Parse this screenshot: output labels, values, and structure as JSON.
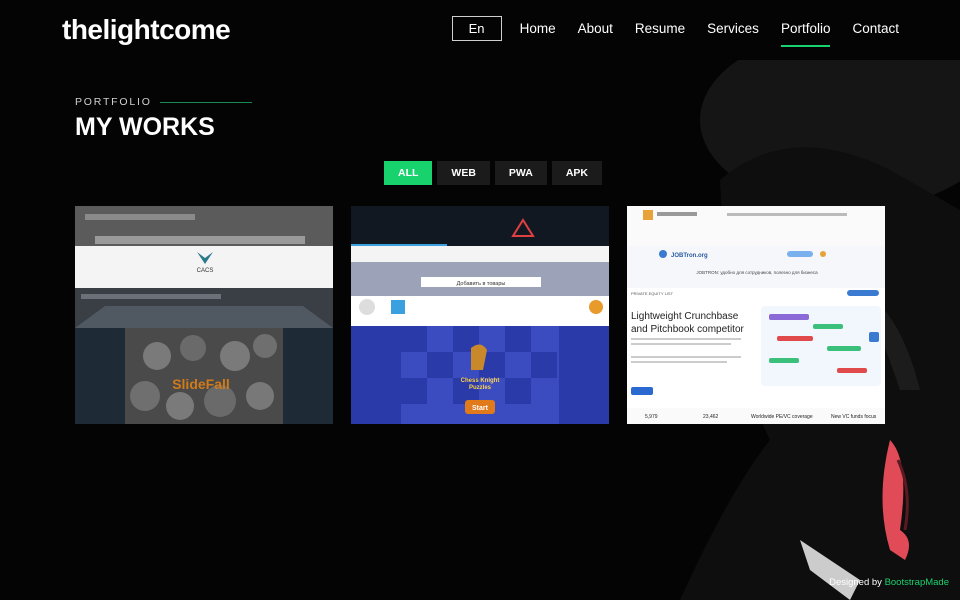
{
  "brand": {
    "logo": "thelightcome"
  },
  "nav": {
    "lang": "En",
    "items": [
      "Home",
      "About",
      "Resume",
      "Services",
      "Portfolio",
      "Contact"
    ],
    "active": "Portfolio"
  },
  "section": {
    "subtitle": "PORTFOLIO",
    "title": "MY WORKS"
  },
  "filters": [
    {
      "label": "ALL",
      "active": true
    },
    {
      "label": "WEB",
      "active": false
    },
    {
      "label": "PWA",
      "active": false
    },
    {
      "label": "APK",
      "active": false
    }
  ],
  "portfolio": {
    "card1": {
      "caas_label": "CACS",
      "game_label": "SlideFall"
    },
    "card2": {
      "game_label_1": "Chess Knight",
      "game_label_2": "Puzzles",
      "game_start": "Start",
      "search_button": "Добавить в товары"
    },
    "card3": {
      "brand": "JOBTron.org",
      "tagline": "JOBTRON: удобно для сотрудников, полезно для бизнеса",
      "headline_1": "Lightweight Crunchbase",
      "headline_2": "and Pitchbook competitor",
      "site_name": "PRIVATE EQUITY LIST",
      "stats": [
        "5,979",
        "23,462",
        "Worldwide PE/VC coverage",
        "New VC funds focus"
      ]
    }
  },
  "footer": {
    "credit_prefix": "Designed by",
    "credit_link": "BootstrapMade"
  },
  "colors": {
    "accent": "#18d26e",
    "background": "#040404"
  }
}
